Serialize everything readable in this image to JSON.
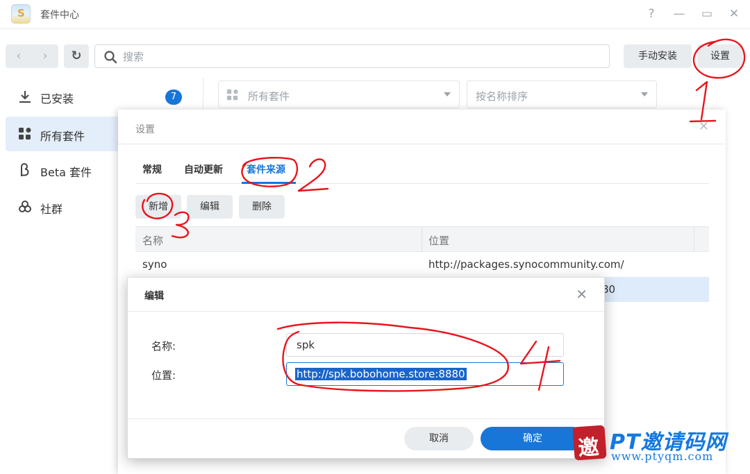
{
  "app": {
    "title": "套件中心"
  },
  "window": {
    "help": "?",
    "minimize": "—",
    "maximize": "▭",
    "close": "✕"
  },
  "toolbar": {
    "back_icon": "‹",
    "forward_icon": "›",
    "refresh_icon": "↻",
    "search_placeholder": "搜索",
    "manual_install": "手动安装",
    "settings": "设置"
  },
  "sidebar": {
    "items": [
      {
        "label": "已安装",
        "icon": "download-icon"
      },
      {
        "label": "所有套件",
        "icon": "grid-icon"
      },
      {
        "label": "Beta 套件",
        "icon": "beta-icon"
      },
      {
        "label": "社群",
        "icon": "community-icon"
      }
    ],
    "installed_count": "7"
  },
  "filters": {
    "category": "所有套件",
    "sort": "按名称排序"
  },
  "settings_dialog": {
    "title": "设置",
    "close": "✕",
    "tabs": [
      "常规",
      "自动更新",
      "套件来源"
    ],
    "active_tab": "套件来源",
    "buttons": {
      "add": "新增",
      "edit": "编辑",
      "delete": "删除"
    },
    "columns": {
      "name": "名称",
      "location": "位置"
    },
    "rows": [
      {
        "name": "syno",
        "location": "http://packages.synocommunity.com/"
      },
      {
        "name": "",
        "location": "80"
      }
    ]
  },
  "edit_dialog": {
    "title": "编辑",
    "close": "✕",
    "name_label": "名称:",
    "name_value": "spk",
    "location_label": "位置:",
    "location_value": "http://spk.bobohome.store:8880",
    "cancel": "取消",
    "ok": "确定"
  },
  "watermark": {
    "seal_char": "邀",
    "brand": "PT邀请码网",
    "url": "www.ptyqm.com"
  },
  "annotations": [
    "1",
    "2",
    "3",
    "4"
  ],
  "colors": {
    "accent": "#1776d8",
    "annotation_red": "#e8141c",
    "selection": "#deebfa"
  }
}
